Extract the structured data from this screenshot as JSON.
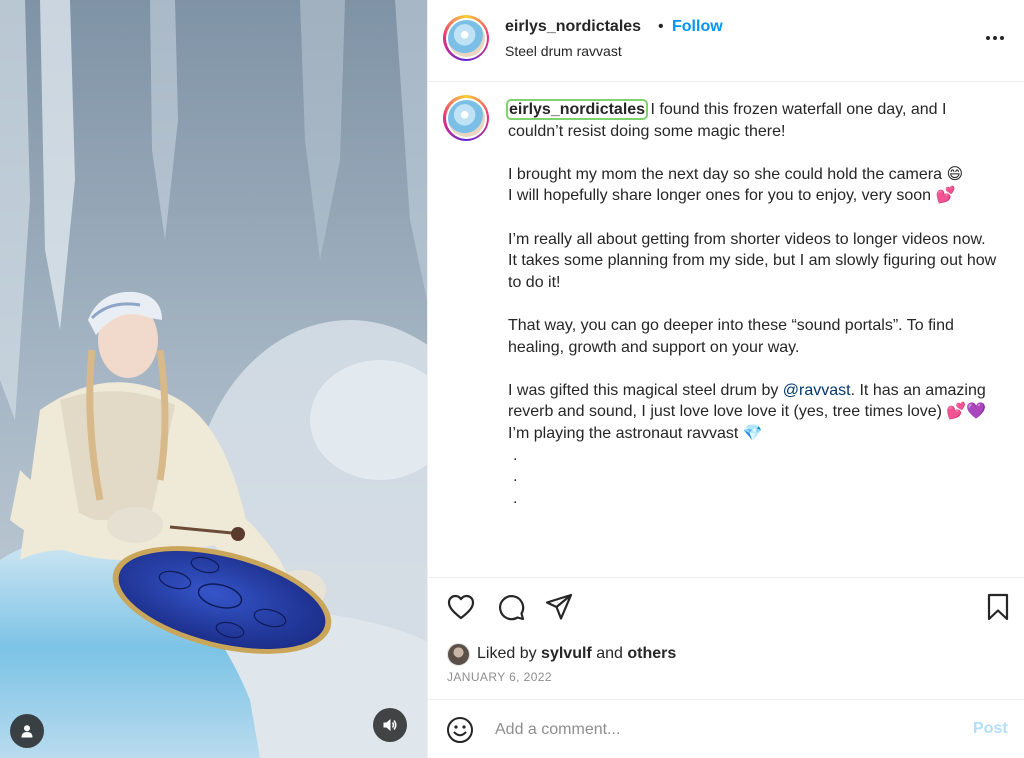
{
  "post": {
    "username": "eirlys_nordictales",
    "header_dot": "•",
    "follow_label": "Follow",
    "subtitle": "Steel drum ravvast"
  },
  "caption": {
    "username": "eirlys_nordictales",
    "p1": "I found this frozen waterfall one day, and I couldn’t resist doing some magic there!",
    "p2_line1": "I brought my mom the next day so she could hold the camera 😄",
    "p2_line2": "I will hopefully share longer ones for you to enjoy, very soon 💕",
    "p3_line1": "I’m really all about getting from shorter videos to longer videos now.",
    "p3_line2": "It takes some planning from my side, but I am slowly figuring out how to do it!",
    "p4": "That way, you can go deeper into these “sound portals”. To find healing, growth and support on your way.",
    "p5_before": "I was gifted this magical steel drum by ",
    "p5_mention": "@ravvast",
    "p5_after": ". It has an amazing reverb and sound, I just love love love it (yes, tree times love) 💕💜",
    "p6": "I’m playing the astronaut ravvast 💎",
    "dot": "."
  },
  "likes": {
    "prefix": "Liked by ",
    "user": "sylvulf",
    "middle": " and ",
    "others": "others"
  },
  "date": "JANUARY 6, 2022",
  "comment": {
    "placeholder": "Add a comment...",
    "post_label": "Post"
  },
  "icons": {
    "user_tag": "person-icon",
    "audio": "speaker-icon",
    "more": "ellipsis-icon",
    "like": "heart-icon",
    "comment": "comment-bubble-icon",
    "share": "paper-plane-icon",
    "save": "bookmark-icon",
    "emoji": "smiley-icon"
  },
  "colors": {
    "follow": "#0095f6",
    "post_disabled": "#b2dffc",
    "mention": "#00376b",
    "secondary_text": "#8e8e8e"
  }
}
